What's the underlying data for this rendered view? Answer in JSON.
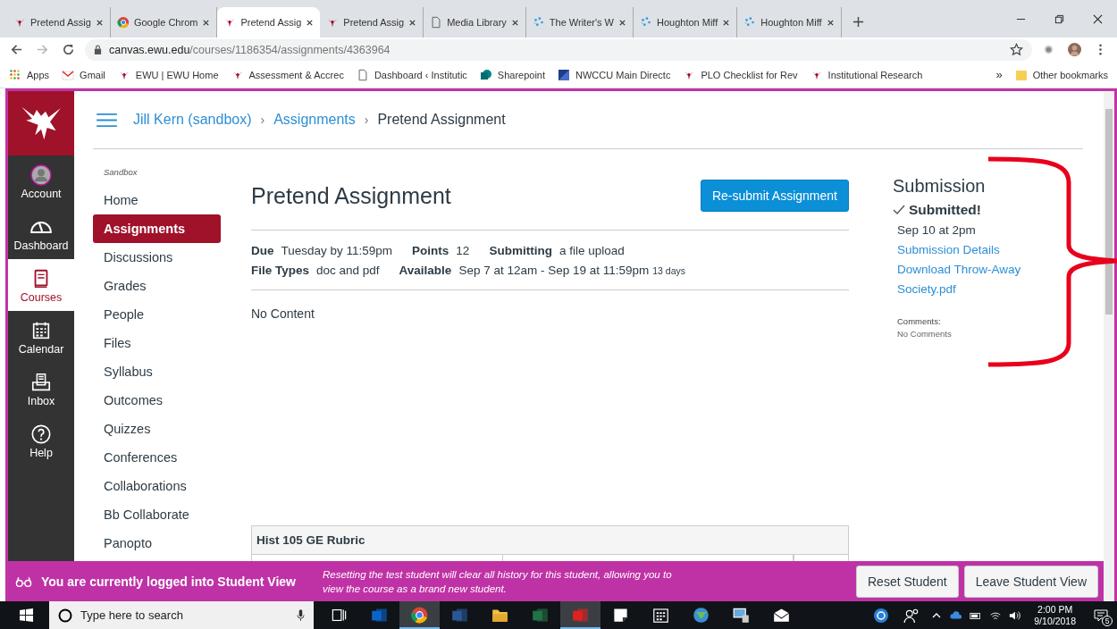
{
  "browser": {
    "tabs": [
      {
        "title": "Pretend Assig",
        "kind": "eagle",
        "selected": false
      },
      {
        "title": "Google Chrom",
        "kind": "chrome",
        "selected": false
      },
      {
        "title": "Pretend Assig",
        "kind": "eagle",
        "selected": true
      },
      {
        "title": "Pretend Assig",
        "kind": "eagle",
        "selected": false
      },
      {
        "title": "Media Library",
        "kind": "page",
        "selected": false
      },
      {
        "title": "The Writer's W",
        "kind": "hmh",
        "selected": false
      },
      {
        "title": "Houghton Miff",
        "kind": "hmh",
        "selected": false
      },
      {
        "title": "Houghton Miff",
        "kind": "hmh",
        "selected": false
      }
    ],
    "url_host": "canvas.ewu.edu",
    "url_path": "/courses/1186354/assignments/4363964",
    "bookmarks": [
      {
        "label": "Apps",
        "kind": "apps"
      },
      {
        "label": "Gmail",
        "kind": "gmail"
      },
      {
        "label": "EWU | EWU Home",
        "kind": "eagle"
      },
      {
        "label": "Assessment & Accrec",
        "kind": "eagle"
      },
      {
        "label": "Dashboard ‹ Institutic",
        "kind": "page"
      },
      {
        "label": "Sharepoint",
        "kind": "sharepoint"
      },
      {
        "label": "NWCCU Main Directc",
        "kind": "nwccu"
      },
      {
        "label": "PLO Checklist for Rev",
        "kind": "eagle"
      },
      {
        "label": "Institutional Research",
        "kind": "eagle"
      }
    ],
    "more": "»",
    "other_bookmarks": "Other bookmarks"
  },
  "global_nav": [
    {
      "label": "Account",
      "kind": "account",
      "selected": false
    },
    {
      "label": "Dashboard",
      "kind": "dashboard",
      "selected": false
    },
    {
      "label": "Courses",
      "kind": "courses",
      "selected": true
    },
    {
      "label": "Calendar",
      "kind": "calendar",
      "selected": false
    },
    {
      "label": "Inbox",
      "kind": "inbox",
      "selected": false
    },
    {
      "label": "Help",
      "kind": "help",
      "selected": false
    }
  ],
  "breadcrumbs": [
    {
      "label": "Jill Kern (sandbox)",
      "link": true
    },
    {
      "label": "Assignments",
      "link": true
    },
    {
      "label": "Pretend Assignment",
      "link": false
    }
  ],
  "breadcrumb_separator": "›",
  "course_nav": {
    "term": "Sandbox",
    "items": [
      {
        "label": "Home",
        "selected": false
      },
      {
        "label": "Assignments",
        "selected": true
      },
      {
        "label": "Discussions",
        "selected": false
      },
      {
        "label": "Grades",
        "selected": false
      },
      {
        "label": "People",
        "selected": false
      },
      {
        "label": "Files",
        "selected": false
      },
      {
        "label": "Syllabus",
        "selected": false
      },
      {
        "label": "Outcomes",
        "selected": false
      },
      {
        "label": "Quizzes",
        "selected": false
      },
      {
        "label": "Conferences",
        "selected": false
      },
      {
        "label": "Collaborations",
        "selected": false
      },
      {
        "label": "Bb Collaborate",
        "selected": false
      },
      {
        "label": "Panopto",
        "selected": false
      }
    ]
  },
  "assignment": {
    "title": "Pretend Assignment",
    "resubmit_button": "Re-submit Assignment",
    "details": [
      {
        "label": "Due",
        "value": "Tuesday by 11:59pm"
      },
      {
        "label": "Points",
        "value": "12"
      },
      {
        "label": "Submitting",
        "value": "a file upload"
      },
      {
        "label": "File Types",
        "value": "doc and pdf"
      },
      {
        "label": "Available",
        "value": "Sep 7 at 12am - Sep 19 at 11:59pm",
        "note": "13 days"
      }
    ],
    "body": "No Content",
    "rubric_title": "Hist 105 GE Rubric"
  },
  "submission": {
    "heading": "Submission",
    "status": "Submitted!",
    "date": "Sep 10 at 2pm",
    "details_link": "Submission Details",
    "download_link": "Download Throw-Away Society.pdf",
    "comments_label": "Comments:",
    "comments": "No Comments"
  },
  "student_view": {
    "message": "You are currently logged into Student View",
    "note": "Resetting the test student will clear all history for this student, allowing you to view the course as a brand new student.",
    "buttons": [
      "Reset Student",
      "Leave Student View"
    ]
  },
  "taskbar": {
    "search_placeholder": "Type here to search",
    "apps": [
      {
        "kind": "taskview",
        "active": false
      },
      {
        "kind": "outlook",
        "active": false
      },
      {
        "kind": "chrome",
        "active": true
      },
      {
        "kind": "word",
        "active": false
      },
      {
        "kind": "explorer",
        "active": false
      },
      {
        "kind": "excel",
        "active": false
      },
      {
        "kind": "acrobat",
        "active": true
      },
      {
        "kind": "sticky",
        "active": false
      },
      {
        "kind": "calendar",
        "active": false
      },
      {
        "kind": "globe",
        "active": false
      },
      {
        "kind": "network",
        "active": false
      },
      {
        "kind": "mail",
        "active": false
      }
    ],
    "time": "2:00 PM",
    "date": "9/10/2018",
    "notifications": "5"
  }
}
